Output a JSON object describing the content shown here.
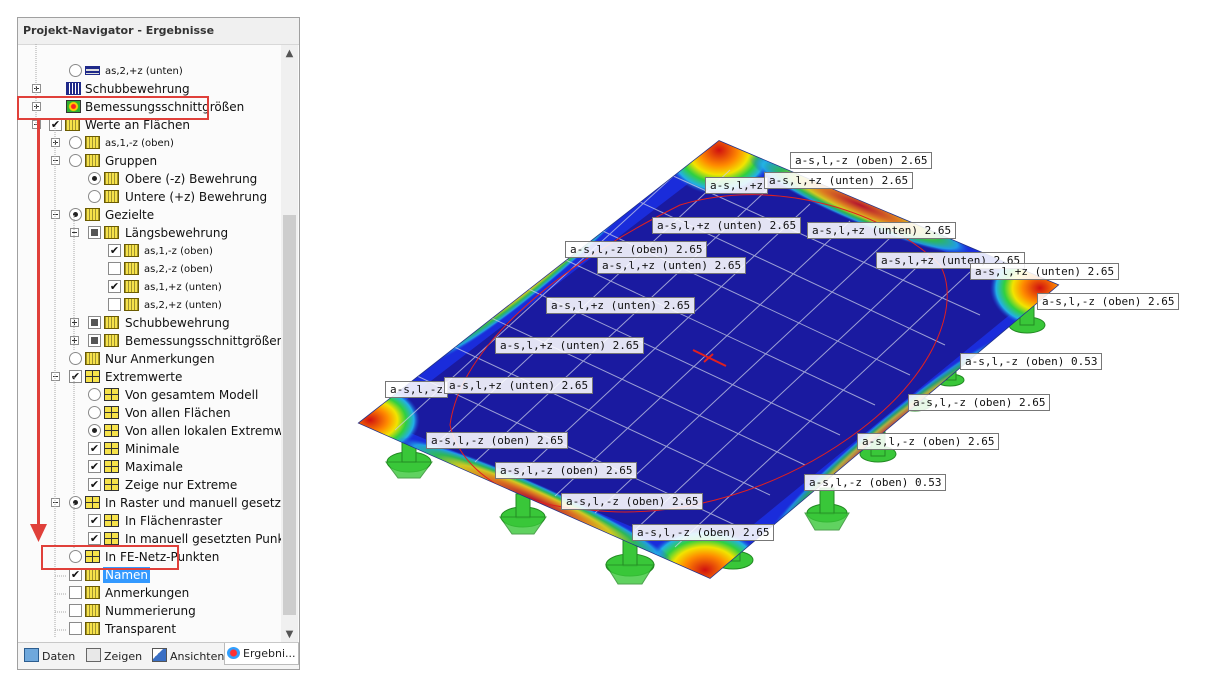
{
  "panel": {
    "title": "Projekt-Navigator - Ergebnisse",
    "tree": [
      {
        "label": "as,2,+z (unten)"
      },
      {
        "label": "Schubbewehrung"
      },
      {
        "label": "Bemessungsschnittgrößen"
      },
      {
        "label": "Werte an Flächen"
      },
      {
        "label": "as,1,-z (oben)"
      },
      {
        "label": "Gruppen"
      },
      {
        "label": "Obere (-z) Bewehrung"
      },
      {
        "label": "Untere (+z) Bewehrung"
      },
      {
        "label": "Gezielte"
      },
      {
        "label": "Längsbewehrung"
      },
      {
        "label": "as,1,-z (oben)"
      },
      {
        "label": "as,2,-z (oben)"
      },
      {
        "label": "as,1,+z (unten)"
      },
      {
        "label": "as,2,+z (unten)"
      },
      {
        "label": "Schubbewehrung"
      },
      {
        "label": "Bemessungsschnittgrößen"
      },
      {
        "label": "Nur Anmerkungen"
      },
      {
        "label": "Extremwerte"
      },
      {
        "label": "Von gesamtem Modell"
      },
      {
        "label": "Von allen Flächen"
      },
      {
        "label": "Von allen lokalen Extremwert"
      },
      {
        "label": "Minimale"
      },
      {
        "label": "Maximale"
      },
      {
        "label": "Zeige nur Extreme"
      },
      {
        "label": "In Raster und manuell gesetzten"
      },
      {
        "label": "In Flächenraster"
      },
      {
        "label": "In manuell gesetzten Punkter"
      },
      {
        "label": "In FE-Netz-Punkten"
      },
      {
        "label": "Namen"
      },
      {
        "label": "Anmerkungen"
      },
      {
        "label": "Nummerierung"
      },
      {
        "label": "Transparent"
      }
    ],
    "tabs": [
      {
        "label": "Daten"
      },
      {
        "label": "Zeigen"
      },
      {
        "label": "Ansichten"
      },
      {
        "label": "Ergebni..."
      }
    ],
    "check": "✔",
    "scroll": {
      "up": "▲",
      "down": "▼",
      "left": "<",
      "right": ">"
    }
  },
  "view": {
    "labels": [
      {
        "text": "a-s,l,-z (oben)  2.65"
      },
      {
        "text": "a-s,l,+z"
      },
      {
        "text": "a-s,l,+z (unten)  2.65"
      },
      {
        "text": "a-s,l,+z (unten)  2.65"
      },
      {
        "text": "a-s,l,+z (unten)  2.65"
      },
      {
        "text": "a-s,l,-z (oben)  2.65"
      },
      {
        "text": "a-s,l,+z (unten)  2.65"
      },
      {
        "text": "a-s,l,+z (unten)  2.65"
      },
      {
        "text": "a-s,l,+z (unten)  2.65"
      },
      {
        "text": "a-s,l,-z (oben)  2.65"
      },
      {
        "text": "a-s,l,+z (unten)  2.65"
      },
      {
        "text": "a-s,l,+z (unten)  2.65"
      },
      {
        "text": "a-s,l,-z (oben)  0.53"
      },
      {
        "text": "a-s,l,-z"
      },
      {
        "text": "a-s,l,+z (unten)  2.65"
      },
      {
        "text": "a-s,l,-z (oben)  2.65"
      },
      {
        "text": "a-s,l,-z (oben)  2.65"
      },
      {
        "text": "a-s,l,-z (oben)  2.65"
      },
      {
        "text": "a-s,l,-z (oben)  2.65"
      },
      {
        "text": "a-s,l,-z (oben)  0.53"
      },
      {
        "text": "a-s,l,-z (oben)  2.65"
      },
      {
        "text": "a-s,l,-z (oben)  2.65"
      }
    ]
  },
  "colors": {
    "highlight": "#e0403a",
    "selection": "#3399ff",
    "plate": "#1a1fa8",
    "support": "#39c739"
  }
}
